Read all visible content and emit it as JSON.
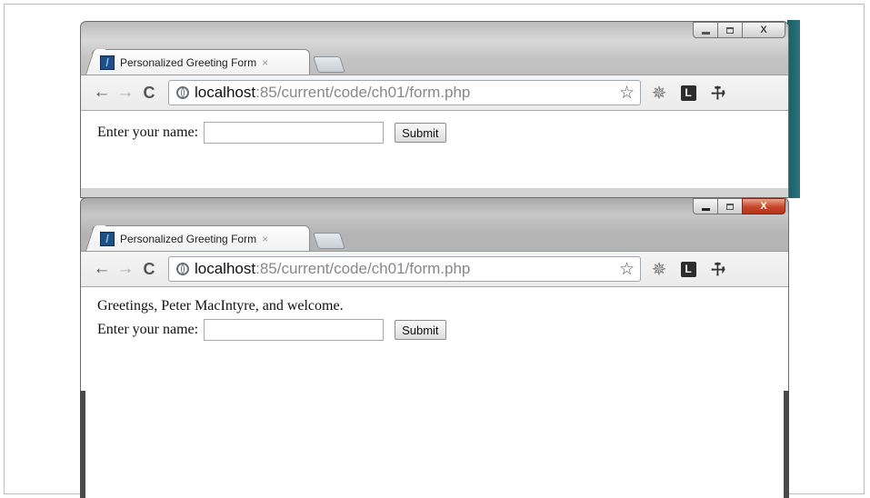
{
  "browser_windows": [
    {
      "tab": {
        "title": "Personalized Greeting Form",
        "close_glyph": "×"
      },
      "address": {
        "host": "localhost",
        "path": ":85/current/code/ch01/form.php"
      },
      "content": {
        "greeting": "",
        "label": "Enter your name:",
        "input_value": "",
        "submit_label": "Submit"
      }
    },
    {
      "tab": {
        "title": "Personalized Greeting Form",
        "close_glyph": "×"
      },
      "address": {
        "host": "localhost",
        "path": ":85/current/code/ch01/form.php"
      },
      "content": {
        "greeting": "Greetings, Peter MacIntyre, and welcome.",
        "label": "Enter your name:",
        "input_value": "",
        "submit_label": "Submit"
      }
    }
  ],
  "icons": {
    "back": "←",
    "forward": "→",
    "reload": "C",
    "star": "☆",
    "gear": "✵",
    "l_ext": "L",
    "wrench": "🔧",
    "close_x": "X"
  }
}
